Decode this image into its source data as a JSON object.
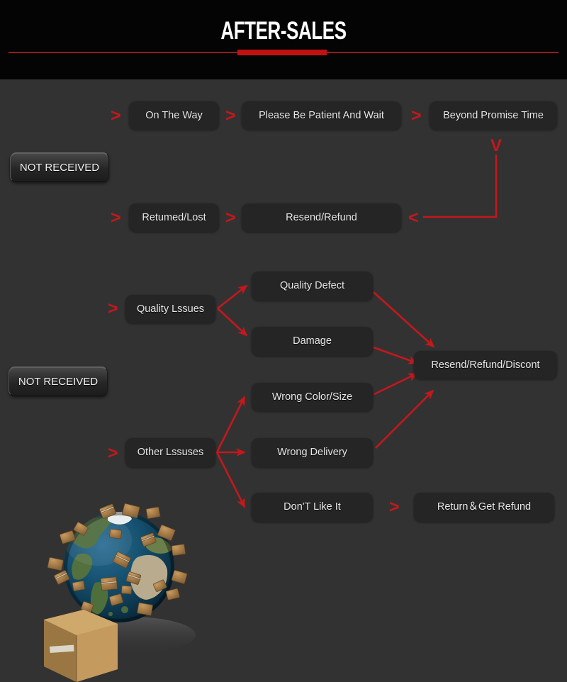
{
  "header": {
    "title": "AFTER-SALES",
    "accent_color": "#c11111",
    "rule_color": "#931d1d",
    "background": "#040404"
  },
  "theme": {
    "page_background": "#333232",
    "box_background": "#252525",
    "box_text_color": "#e8e8e8",
    "arrow_color": "#c4181c"
  },
  "flow": {
    "categories": [
      {
        "label": "NOT RECEIVED"
      },
      {
        "label": "NOT RECEIVED"
      }
    ],
    "nodes": [
      {
        "id": "on-the-way",
        "label": "On The Way"
      },
      {
        "id": "please-be-patient",
        "label": "Please Be Patient And Wait"
      },
      {
        "id": "beyond-promise",
        "label": "Beyond Promise Time"
      },
      {
        "id": "returned-lost",
        "label": "Retumed/Lost"
      },
      {
        "id": "resend-refund",
        "label": "Resend/Refund"
      },
      {
        "id": "quality-issues",
        "label": "Quality Lssues"
      },
      {
        "id": "quality-defect",
        "label": "Quality Defect"
      },
      {
        "id": "damage",
        "label": "Damage"
      },
      {
        "id": "resend-refund-discount",
        "label": "Resend/Refund/Discont"
      },
      {
        "id": "wrong-color-size",
        "label": "Wrong Color/Size"
      },
      {
        "id": "other-issues",
        "label": "Other Lssuses"
      },
      {
        "id": "wrong-delivery",
        "label": "Wrong Delivery"
      },
      {
        "id": "dont-like-it",
        "label": "Don'T Like It"
      },
      {
        "id": "return-get-refund",
        "label": "Return＆Get Refund"
      }
    ],
    "chevrons": [
      {
        "id": "chev-on-the-way",
        "glyph": ">"
      },
      {
        "id": "chev-please-wait",
        "glyph": ">"
      },
      {
        "id": "chev-beyond",
        "glyph": ">"
      },
      {
        "id": "chev-returned-lost",
        "glyph": ">"
      },
      {
        "id": "chev-resend-refund",
        "glyph": ">"
      },
      {
        "id": "chev-back-left",
        "glyph": "<"
      },
      {
        "id": "chev-down-v",
        "glyph": "V"
      },
      {
        "id": "chev-quality",
        "glyph": ">"
      },
      {
        "id": "chev-other",
        "glyph": ">"
      },
      {
        "id": "chev-return-refund",
        "glyph": ">"
      }
    ]
  },
  "illustration": {
    "name": "globe-with-parcels",
    "caption": ""
  }
}
